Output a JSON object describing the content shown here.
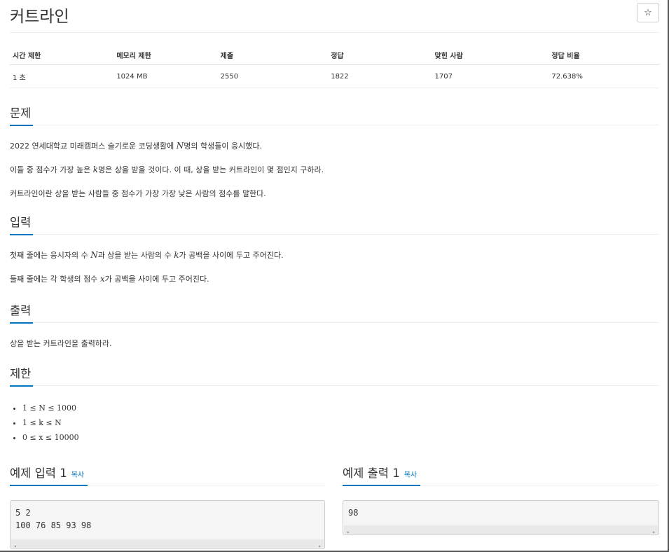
{
  "title": "커트라인",
  "star_icon": "☆",
  "stats": {
    "headers": [
      "시간 제한",
      "메모리 제한",
      "제출",
      "정답",
      "맞힌 사람",
      "정답 비율"
    ],
    "values": [
      "1 초",
      "1024 MB",
      "2550",
      "1822",
      "1707",
      "72.638%"
    ]
  },
  "problem": {
    "heading": "문제",
    "line1_pre": "2022 연세대학교 미래캠퍼스 슬기로운 코딩생활에 ",
    "line1_var": "N",
    "line1_post": "명의 학생들이 응시했다.",
    "line2_pre": "이들 중 점수가 가장 높은 ",
    "line2_var": "k",
    "line2_post": "명은 상을 받을 것이다. 이 때, 상을 받는 커트라인이 몇 점인지 구하라.",
    "line3": "커트라인이란 상을 받는 사람들 중 점수가 가장 가장 낮은 사람의 점수를 말한다."
  },
  "input": {
    "heading": "입력",
    "line1_pre": "첫째 줄에는 응시자의 수 ",
    "line1_var1": "N",
    "line1_mid": "과 상을 받는 사람의 수 ",
    "line1_var2": "k",
    "line1_post": "가 공백을 사이에 두고 주어진다.",
    "line2_pre": "둘째 줄에는 각 학생의 점수 ",
    "line2_var": "x",
    "line2_post": "가 공백을 사이에 두고 주어진다."
  },
  "output": {
    "heading": "출력",
    "line1": "상을 받는 커트라인을 출력하라."
  },
  "limits": {
    "heading": "제한",
    "items": [
      "1 ≤ N ≤ 1000",
      "1 ≤ k ≤ N",
      "0 ≤ x ≤ 10000"
    ]
  },
  "sample_input": {
    "heading": "예제 입력 1",
    "copy": "복사",
    "text": "5 2\n100 76 85 93 98"
  },
  "sample_output": {
    "heading": "예제 출력 1",
    "copy": "복사",
    "text": "98"
  },
  "scroll_left_icon": "◂",
  "scroll_right_icon": "▸"
}
